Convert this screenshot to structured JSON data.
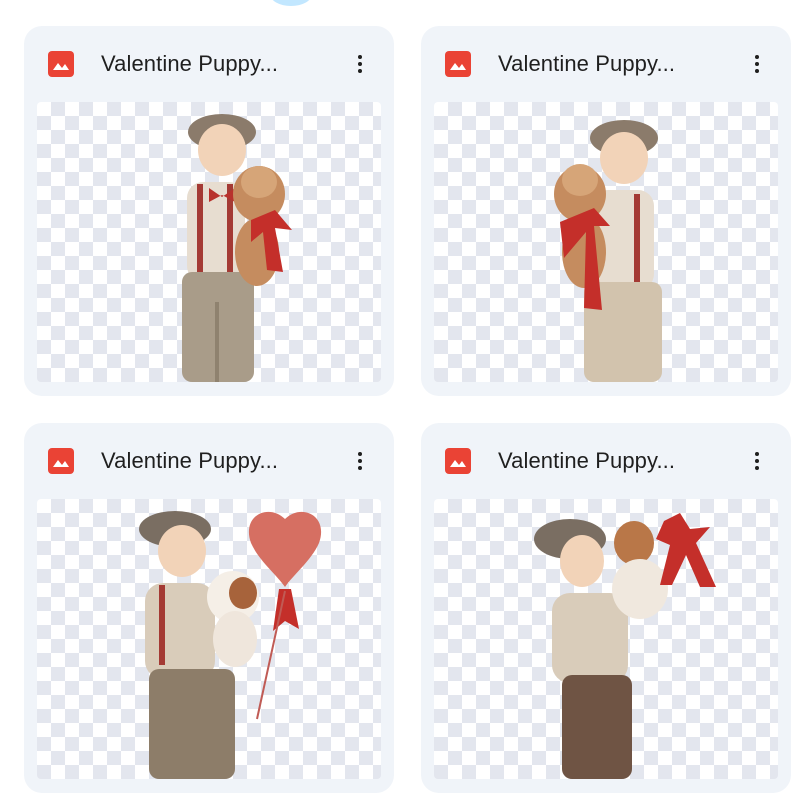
{
  "files": [
    {
      "title": "Valentine Puppy...",
      "type_icon": "image-file-icon",
      "menu_icon": "more-vert-icon",
      "variant": "boy-puppy-bow"
    },
    {
      "title": "Valentine Puppy...",
      "type_icon": "image-file-icon",
      "menu_icon": "more-vert-icon",
      "variant": "boy-puppy-bow-left"
    },
    {
      "title": "Valentine Puppy...",
      "type_icon": "image-file-icon",
      "menu_icon": "more-vert-icon",
      "variant": "boy-puppy-balloon"
    },
    {
      "title": "Valentine Puppy...",
      "type_icon": "image-file-icon",
      "menu_icon": "more-vert-icon",
      "variant": "boy-puppy-gift"
    }
  ],
  "colors": {
    "card_bg": "#f0f4f9",
    "icon_red": "#ea4335",
    "text": "#1f1f1f",
    "accent_circle": "#c2e7ff"
  }
}
